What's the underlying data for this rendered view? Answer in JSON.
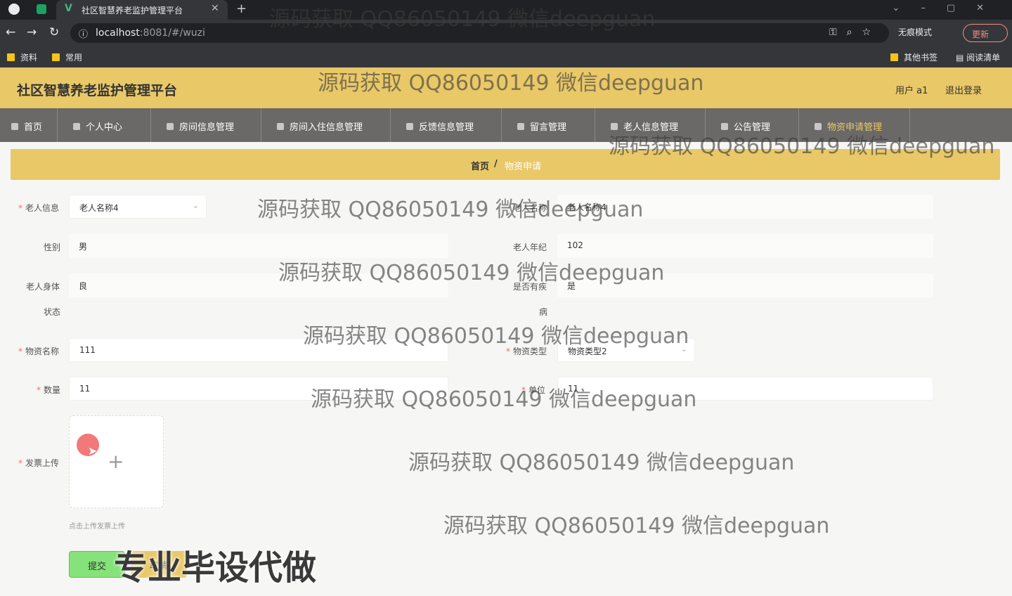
{
  "browser": {
    "tab_title": "社区智慧养老监护管理平台",
    "tab_close": "✕",
    "tab_new": "+",
    "url_host": "localhost",
    "url_path": ":8081/#/wuzi",
    "incognito": "无痕模式",
    "update": "更新",
    "bookmarks": [
      "资料",
      "常用"
    ],
    "bookmarks_right": [
      "其他书签",
      "阅读清单"
    ]
  },
  "header": {
    "title": "社区智慧养老监护管理平台",
    "user": "用户 a1",
    "logout": "退出登录"
  },
  "menu": [
    "首页",
    "个人中心",
    "房间信息管理",
    "房间入住信息管理",
    "反馈信息管理",
    "留言管理",
    "老人信息管理",
    "公告管理",
    "物资申请管理"
  ],
  "breadcrumb": {
    "home": "首页",
    "sep": "/",
    "current": "物资申请"
  },
  "form": {
    "laoren_info_label": "老人信息",
    "laoren_info_value": "老人名称4",
    "laoren_name_label": "老人名称",
    "laoren_name_value": "老人名称4",
    "gender_label": "性别",
    "gender_value": "男",
    "age_label": "老人年纪",
    "age_value": "102",
    "body_label_1": "老人身体",
    "body_label_2": "状态",
    "body_value": "良",
    "disease_label_1": "是否有疾",
    "disease_label_2": "病",
    "disease_value": "是",
    "wuzi_name_label": "物资名称",
    "wuzi_name_value": "111",
    "wuzi_type_label": "物资类型",
    "wuzi_type_value": "物资类型2",
    "quantity_label": "数量",
    "quantity_value": "11",
    "unit_label": "单位",
    "unit_value": "11",
    "invoice_label": "发票上传",
    "upload_tip": "点击上传发票上传",
    "submit": "提交",
    "cancel": "取消"
  },
  "watermark": "源码获取 QQ86050149 微信deepguan",
  "promo": "专业毕设代做"
}
